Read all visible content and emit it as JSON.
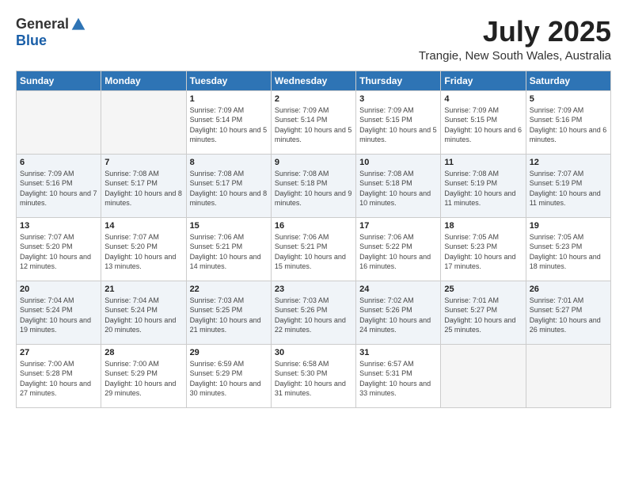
{
  "logo": {
    "general": "General",
    "blue": "Blue"
  },
  "title": {
    "month_year": "July 2025",
    "location": "Trangie, New South Wales, Australia"
  },
  "headers": [
    "Sunday",
    "Monday",
    "Tuesday",
    "Wednesday",
    "Thursday",
    "Friday",
    "Saturday"
  ],
  "weeks": [
    [
      {
        "day": "",
        "sunrise": "",
        "sunset": "",
        "daylight": ""
      },
      {
        "day": "",
        "sunrise": "",
        "sunset": "",
        "daylight": ""
      },
      {
        "day": "1",
        "sunrise": "Sunrise: 7:09 AM",
        "sunset": "Sunset: 5:14 PM",
        "daylight": "Daylight: 10 hours and 5 minutes."
      },
      {
        "day": "2",
        "sunrise": "Sunrise: 7:09 AM",
        "sunset": "Sunset: 5:14 PM",
        "daylight": "Daylight: 10 hours and 5 minutes."
      },
      {
        "day": "3",
        "sunrise": "Sunrise: 7:09 AM",
        "sunset": "Sunset: 5:15 PM",
        "daylight": "Daylight: 10 hours and 5 minutes."
      },
      {
        "day": "4",
        "sunrise": "Sunrise: 7:09 AM",
        "sunset": "Sunset: 5:15 PM",
        "daylight": "Daylight: 10 hours and 6 minutes."
      },
      {
        "day": "5",
        "sunrise": "Sunrise: 7:09 AM",
        "sunset": "Sunset: 5:16 PM",
        "daylight": "Daylight: 10 hours and 6 minutes."
      }
    ],
    [
      {
        "day": "6",
        "sunrise": "Sunrise: 7:09 AM",
        "sunset": "Sunset: 5:16 PM",
        "daylight": "Daylight: 10 hours and 7 minutes."
      },
      {
        "day": "7",
        "sunrise": "Sunrise: 7:08 AM",
        "sunset": "Sunset: 5:17 PM",
        "daylight": "Daylight: 10 hours and 8 minutes."
      },
      {
        "day": "8",
        "sunrise": "Sunrise: 7:08 AM",
        "sunset": "Sunset: 5:17 PM",
        "daylight": "Daylight: 10 hours and 8 minutes."
      },
      {
        "day": "9",
        "sunrise": "Sunrise: 7:08 AM",
        "sunset": "Sunset: 5:18 PM",
        "daylight": "Daylight: 10 hours and 9 minutes."
      },
      {
        "day": "10",
        "sunrise": "Sunrise: 7:08 AM",
        "sunset": "Sunset: 5:18 PM",
        "daylight": "Daylight: 10 hours and 10 minutes."
      },
      {
        "day": "11",
        "sunrise": "Sunrise: 7:08 AM",
        "sunset": "Sunset: 5:19 PM",
        "daylight": "Daylight: 10 hours and 11 minutes."
      },
      {
        "day": "12",
        "sunrise": "Sunrise: 7:07 AM",
        "sunset": "Sunset: 5:19 PM",
        "daylight": "Daylight: 10 hours and 11 minutes."
      }
    ],
    [
      {
        "day": "13",
        "sunrise": "Sunrise: 7:07 AM",
        "sunset": "Sunset: 5:20 PM",
        "daylight": "Daylight: 10 hours and 12 minutes."
      },
      {
        "day": "14",
        "sunrise": "Sunrise: 7:07 AM",
        "sunset": "Sunset: 5:20 PM",
        "daylight": "Daylight: 10 hours and 13 minutes."
      },
      {
        "day": "15",
        "sunrise": "Sunrise: 7:06 AM",
        "sunset": "Sunset: 5:21 PM",
        "daylight": "Daylight: 10 hours and 14 minutes."
      },
      {
        "day": "16",
        "sunrise": "Sunrise: 7:06 AM",
        "sunset": "Sunset: 5:21 PM",
        "daylight": "Daylight: 10 hours and 15 minutes."
      },
      {
        "day": "17",
        "sunrise": "Sunrise: 7:06 AM",
        "sunset": "Sunset: 5:22 PM",
        "daylight": "Daylight: 10 hours and 16 minutes."
      },
      {
        "day": "18",
        "sunrise": "Sunrise: 7:05 AM",
        "sunset": "Sunset: 5:23 PM",
        "daylight": "Daylight: 10 hours and 17 minutes."
      },
      {
        "day": "19",
        "sunrise": "Sunrise: 7:05 AM",
        "sunset": "Sunset: 5:23 PM",
        "daylight": "Daylight: 10 hours and 18 minutes."
      }
    ],
    [
      {
        "day": "20",
        "sunrise": "Sunrise: 7:04 AM",
        "sunset": "Sunset: 5:24 PM",
        "daylight": "Daylight: 10 hours and 19 minutes."
      },
      {
        "day": "21",
        "sunrise": "Sunrise: 7:04 AM",
        "sunset": "Sunset: 5:24 PM",
        "daylight": "Daylight: 10 hours and 20 minutes."
      },
      {
        "day": "22",
        "sunrise": "Sunrise: 7:03 AM",
        "sunset": "Sunset: 5:25 PM",
        "daylight": "Daylight: 10 hours and 21 minutes."
      },
      {
        "day": "23",
        "sunrise": "Sunrise: 7:03 AM",
        "sunset": "Sunset: 5:26 PM",
        "daylight": "Daylight: 10 hours and 22 minutes."
      },
      {
        "day": "24",
        "sunrise": "Sunrise: 7:02 AM",
        "sunset": "Sunset: 5:26 PM",
        "daylight": "Daylight: 10 hours and 24 minutes."
      },
      {
        "day": "25",
        "sunrise": "Sunrise: 7:01 AM",
        "sunset": "Sunset: 5:27 PM",
        "daylight": "Daylight: 10 hours and 25 minutes."
      },
      {
        "day": "26",
        "sunrise": "Sunrise: 7:01 AM",
        "sunset": "Sunset: 5:27 PM",
        "daylight": "Daylight: 10 hours and 26 minutes."
      }
    ],
    [
      {
        "day": "27",
        "sunrise": "Sunrise: 7:00 AM",
        "sunset": "Sunset: 5:28 PM",
        "daylight": "Daylight: 10 hours and 27 minutes."
      },
      {
        "day": "28",
        "sunrise": "Sunrise: 7:00 AM",
        "sunset": "Sunset: 5:29 PM",
        "daylight": "Daylight: 10 hours and 29 minutes."
      },
      {
        "day": "29",
        "sunrise": "Sunrise: 6:59 AM",
        "sunset": "Sunset: 5:29 PM",
        "daylight": "Daylight: 10 hours and 30 minutes."
      },
      {
        "day": "30",
        "sunrise": "Sunrise: 6:58 AM",
        "sunset": "Sunset: 5:30 PM",
        "daylight": "Daylight: 10 hours and 31 minutes."
      },
      {
        "day": "31",
        "sunrise": "Sunrise: 6:57 AM",
        "sunset": "Sunset: 5:31 PM",
        "daylight": "Daylight: 10 hours and 33 minutes."
      },
      {
        "day": "",
        "sunrise": "",
        "sunset": "",
        "daylight": ""
      },
      {
        "day": "",
        "sunrise": "",
        "sunset": "",
        "daylight": ""
      }
    ]
  ]
}
